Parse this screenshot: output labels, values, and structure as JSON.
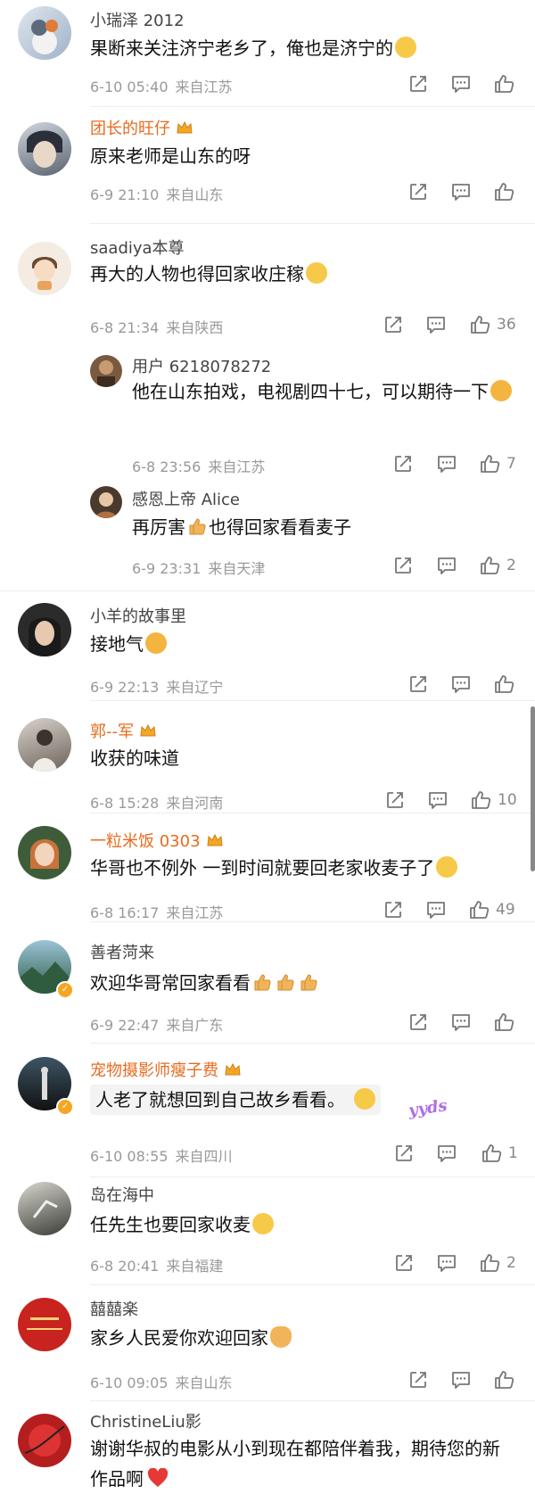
{
  "comments": [
    {
      "name": "小瑞泽 2012",
      "text": "果断来关注济宁老乡了，俺也是济宁的",
      "time": "6-10 05:40",
      "loc": "来自江苏",
      "likes": ""
    },
    {
      "name": "团长的旺仔",
      "text": "原来老师是山东的呀",
      "time": "6-9 21:10",
      "loc": "来自山东",
      "likes": ""
    },
    {
      "name": "saadiya本尊",
      "text": "再大的人物也得回家收庄稼",
      "time": "6-8 21:34",
      "loc": "来自陕西",
      "likes": "36"
    },
    {
      "name": "用户 6218078272",
      "text": "他在山东拍戏，电视剧四十七，可以期待一下",
      "time": "6-8 23:56",
      "loc": "来自江苏",
      "likes": "7"
    },
    {
      "name": "感恩上帝 Alice",
      "text_a": "再厉害",
      "text_b": "也得回家看看麦子",
      "time": "6-9 23:31",
      "loc": "来自天津",
      "likes": "2"
    },
    {
      "name": "小羊的故事里",
      "text": "接地气",
      "time": "6-9 22:13",
      "loc": "来自辽宁",
      "likes": ""
    },
    {
      "name": "郭--军",
      "text": "收获的味道",
      "time": "6-8 15:28",
      "loc": "来自河南",
      "likes": "10"
    },
    {
      "name": "一粒米饭 0303",
      "text": "华哥也不例外 一到时间就要回老家收麦子了",
      "time": "6-8 16:17",
      "loc": "来自江苏",
      "likes": "49"
    },
    {
      "name": "善者菏来",
      "text": "欢迎华哥常回家看看",
      "time": "6-9 22:47",
      "loc": "来自广东",
      "likes": ""
    },
    {
      "name": "宠物摄影师瘦子费",
      "text": "人老了就想回到自己故乡看看。",
      "sticker": "yyds",
      "time": "6-10 08:55",
      "loc": "来自四川",
      "likes": "1"
    },
    {
      "name": "岛在海中",
      "text": "任先生也要回家收麦",
      "time": "6-8 20:41",
      "loc": "来自福建",
      "likes": "2"
    },
    {
      "name": "囍囍楽",
      "text": "家乡人民爱你欢迎回家",
      "time": "6-10 09:05",
      "loc": "来自山东",
      "likes": ""
    },
    {
      "name": "ChristineLiu影",
      "text": "谢谢华叔的电影从小到现在都陪伴着我，期待您的新作品啊",
      "time": "",
      "loc": "",
      "likes": ""
    }
  ],
  "icons": {
    "share": "share-icon",
    "comment": "comment-icon",
    "like": "like-icon",
    "crown": "crown-badge-icon",
    "verified": "verified-badge-icon"
  },
  "colors": {
    "vip_name": "#e86b1f",
    "meta": "#999999",
    "accent": "#f5a623"
  }
}
